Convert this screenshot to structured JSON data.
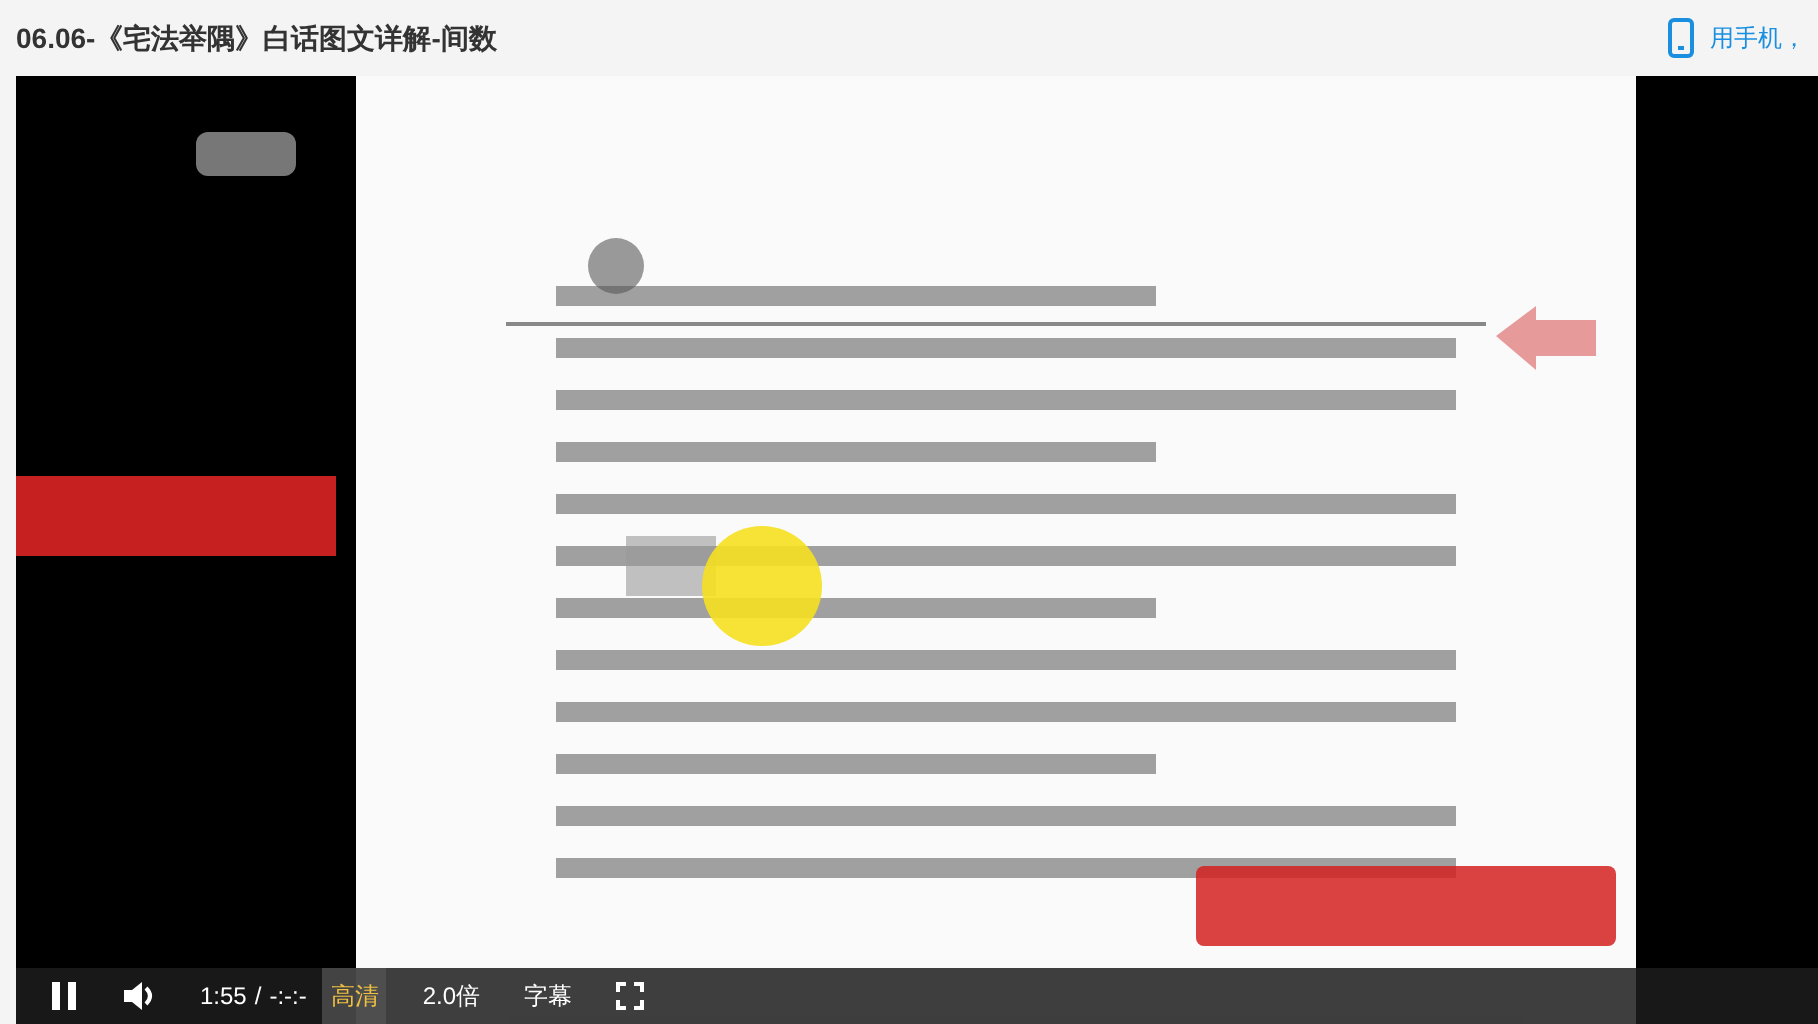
{
  "title": "06.06-《宅法举隅》白话图文详解-间数",
  "mobile_link": "用手机，",
  "player": {
    "playing": true,
    "current_time": "1:55",
    "separator": "/",
    "duration": "-:-:-",
    "controls": [
      {
        "label": "高清",
        "selected": true
      },
      {
        "label": "2.0倍",
        "selected": false
      },
      {
        "label": "字幕",
        "selected": false
      }
    ]
  }
}
